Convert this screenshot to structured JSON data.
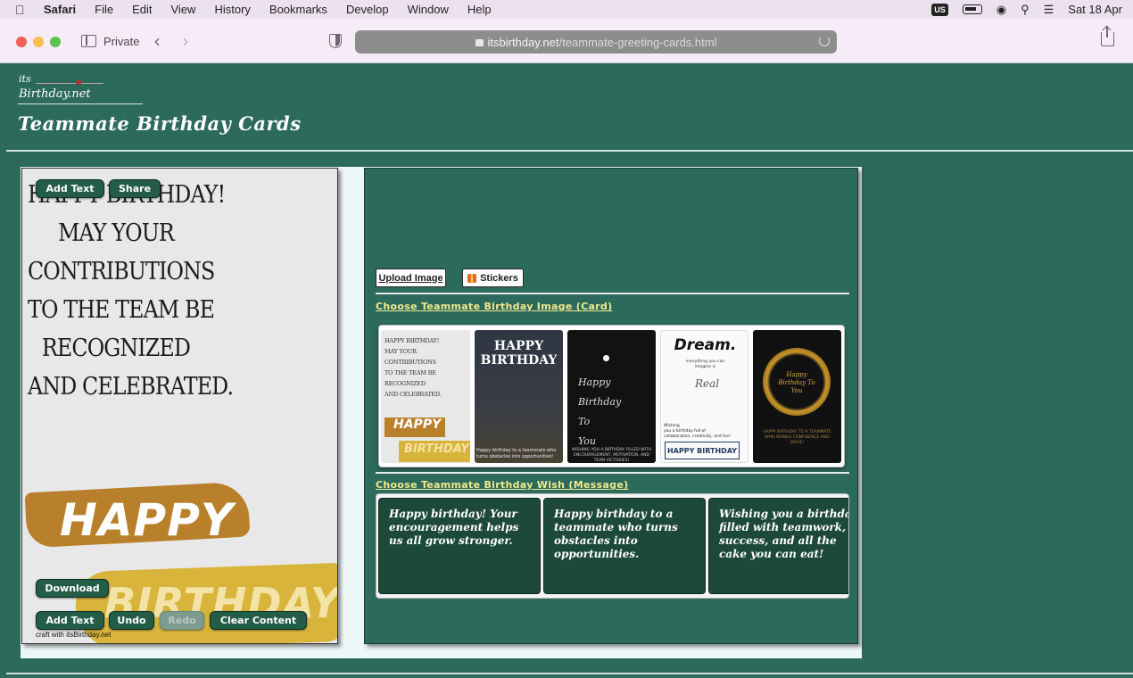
{
  "menubar": {
    "app": "Safari",
    "items": [
      "File",
      "Edit",
      "View",
      "History",
      "Bookmarks",
      "Develop",
      "Window",
      "Help"
    ],
    "input_source": "US",
    "datetime": "Sat 18 Apr"
  },
  "browser": {
    "private_label": "Private",
    "url_host": "itsbirthday.net",
    "url_path": "/teammate-greeting-cards.html"
  },
  "header": {
    "logo_its": "its",
    "logo_name": "Birthday.net",
    "title": "Teammate Birthday Cards"
  },
  "editor": {
    "message_lines": [
      "HAPPY BIRTHDAY!",
      "MAY YOUR",
      "CONTRIBUTIONS",
      "TO THE TEAM BE",
      "RECOGNIZED",
      "AND CELEBRATED."
    ],
    "happy_text": "HAPPY",
    "birthday_text": "BIRTHDAY",
    "top_buttons": {
      "add_text": "Add Text",
      "share": "Share"
    },
    "download_label": "Download",
    "bottom_buttons": {
      "add_text": "Add Text",
      "undo": "Undo",
      "redo": "Redo",
      "clear": "Clear Content"
    },
    "credit": "craft with itsBirthday.net"
  },
  "panel": {
    "upload_label": "Upload Image",
    "stickers_label": "Stickers",
    "choose_image_label": "Choose Teammate Birthday Image (Card)",
    "choose_wish_label": "Choose Teammate Birthday Wish (Message)",
    "thumbnails": {
      "t1": {
        "text": "HAPPY BIRTHDAY!\nMAY YOUR\nCONTRIBUTIONS\nTO THE TEAM BE\nRECOGNIZED\nAND CELEBRATED.",
        "happy": "HAPPY",
        "birthday": "BIRTHDAY"
      },
      "t2": {
        "title": "HAPPY\nBIRTHDAY",
        "caption": "Happy birthday to a teammate who turns obstacles into opportunities!"
      },
      "t3": {
        "script": "Happy\nBirthday\nTo\nYou",
        "caption": "WISHING YOU A BIRTHDAY FILLED WITH ENCOURAGEMENT, MOTIVATION, AND TEAM VICTORIES!"
      },
      "t4": {
        "title": "Dream.",
        "subtitle": "everything you can\nimagine is",
        "script": "Real",
        "wish": "Wishing\nyou a birthday full of\ncollaboration, creativity, and fun!",
        "badge": "HAPPY BIRTHDAY"
      },
      "t5": {
        "script": "Happy\nBirthday To\nYou",
        "caption": "HAPPY BIRTHDAY TO A TEAMMATE WHO BRINGS CONFIDENCE AND DRIVE!"
      }
    },
    "wishes": [
      "Happy birthday! Your encouragement helps us all grow stronger.",
      "Happy birthday to a teammate who turns obstacles into opportunities.",
      "Wishing you a birthday filled with teamwork, success, and all the cake you can eat!"
    ]
  }
}
